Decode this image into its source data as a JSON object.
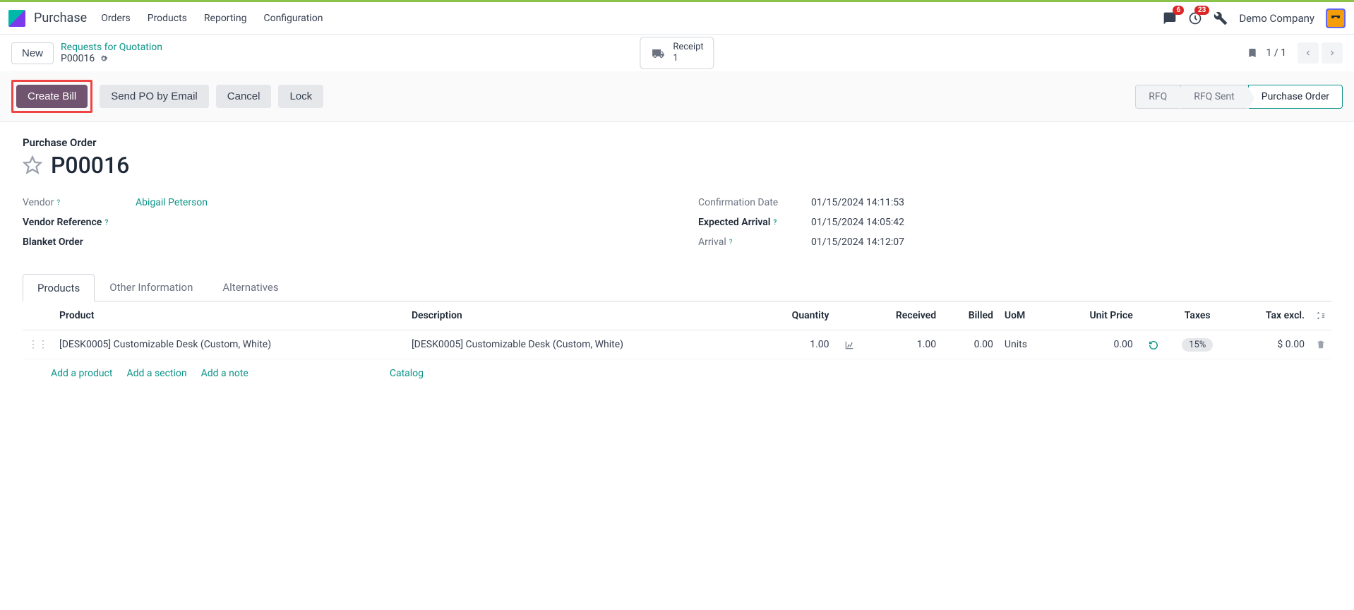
{
  "nav": {
    "app": "Purchase",
    "links": [
      "Orders",
      "Products",
      "Reporting",
      "Configuration"
    ],
    "msgBadge": "6",
    "activityBadge": "23",
    "company": "Demo Company"
  },
  "breadcrumb": {
    "newLabel": "New",
    "parent": "Requests for Quotation",
    "current": "P00016",
    "receiptLabel": "Receipt",
    "receiptCount": "1",
    "pager": "1 / 1"
  },
  "actions": {
    "createBill": "Create Bill",
    "sendPO": "Send PO by Email",
    "cancel": "Cancel",
    "lock": "Lock"
  },
  "status": {
    "rfq": "RFQ",
    "rfqSent": "RFQ Sent",
    "po": "Purchase Order"
  },
  "header": {
    "label": "Purchase Order",
    "number": "P00016"
  },
  "fields": {
    "vendorLabel": "Vendor",
    "vendor": "Abigail Peterson",
    "vendorRefLabel": "Vendor Reference",
    "blanketLabel": "Blanket Order",
    "confirmLabel": "Confirmation Date",
    "confirm": "01/15/2024 14:11:53",
    "expectedLabel": "Expected Arrival",
    "expected": "01/15/2024 14:05:42",
    "arrivalLabel": "Arrival",
    "arrival": "01/15/2024 14:12:07"
  },
  "tabs": {
    "products": "Products",
    "other": "Other Information",
    "alternatives": "Alternatives"
  },
  "table": {
    "headers": {
      "product": "Product",
      "description": "Description",
      "quantity": "Quantity",
      "received": "Received",
      "billed": "Billed",
      "uom": "UoM",
      "unitPrice": "Unit Price",
      "taxes": "Taxes",
      "taxExcl": "Tax excl."
    },
    "row": {
      "product": "[DESK0005] Customizable Desk (Custom, White)",
      "description": "[DESK0005] Customizable Desk (Custom, White)",
      "quantity": "1.00",
      "received": "1.00",
      "billed": "0.00",
      "uom": "Units",
      "unitPrice": "0.00",
      "taxes": "15%",
      "taxExcl": "$ 0.00"
    }
  },
  "addLinks": {
    "product": "Add a product",
    "section": "Add a section",
    "note": "Add a note",
    "catalog": "Catalog"
  }
}
